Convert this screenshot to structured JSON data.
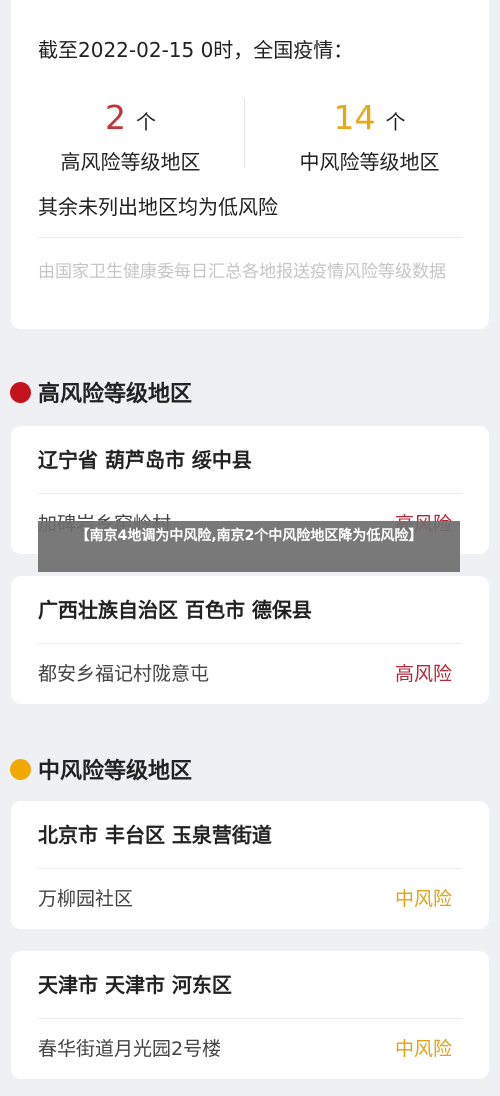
{
  "summary": {
    "as_of": "截至2022-02-15 0时，全国疫情：",
    "high": {
      "count": "2",
      "unit": "个",
      "label": "高风险等级地区",
      "color": "#c0343c"
    },
    "medium": {
      "count": "14",
      "unit": "个",
      "label": "中风险等级地区",
      "color": "#e6a817"
    },
    "others": "其余未列出地区均为低风险",
    "source": "由国家卫生健康委每日汇总各地报送疫情风险等级数据"
  },
  "sections": {
    "high": {
      "title": "高风险等级地区",
      "color": "#c4121f",
      "areas": [
        {
          "title": "辽宁省 葫芦岛市 绥中县",
          "place": "加碑岩乡窑岭村",
          "level": "高风险"
        },
        {
          "title": "广西壮族自治区 百色市 德保县",
          "place": "都安乡福记村陇意屯",
          "level": "高风险"
        }
      ]
    },
    "medium": {
      "title": "中风险等级地区",
      "color": "#f0a900",
      "areas": [
        {
          "title": "北京市 丰台区 玉泉营街道",
          "place": "万柳园社区",
          "level": "中风险"
        },
        {
          "title": "天津市 天津市 河东区",
          "place": "春华街道月光园2号楼",
          "level": "中风险"
        }
      ]
    }
  },
  "banner": {
    "text": "【南京4地调为中风险,南京2个中风险地区降为低风险】"
  },
  "colors": {
    "high_level_text": "#b2293a",
    "medium_level_text": "#e0a21a"
  }
}
